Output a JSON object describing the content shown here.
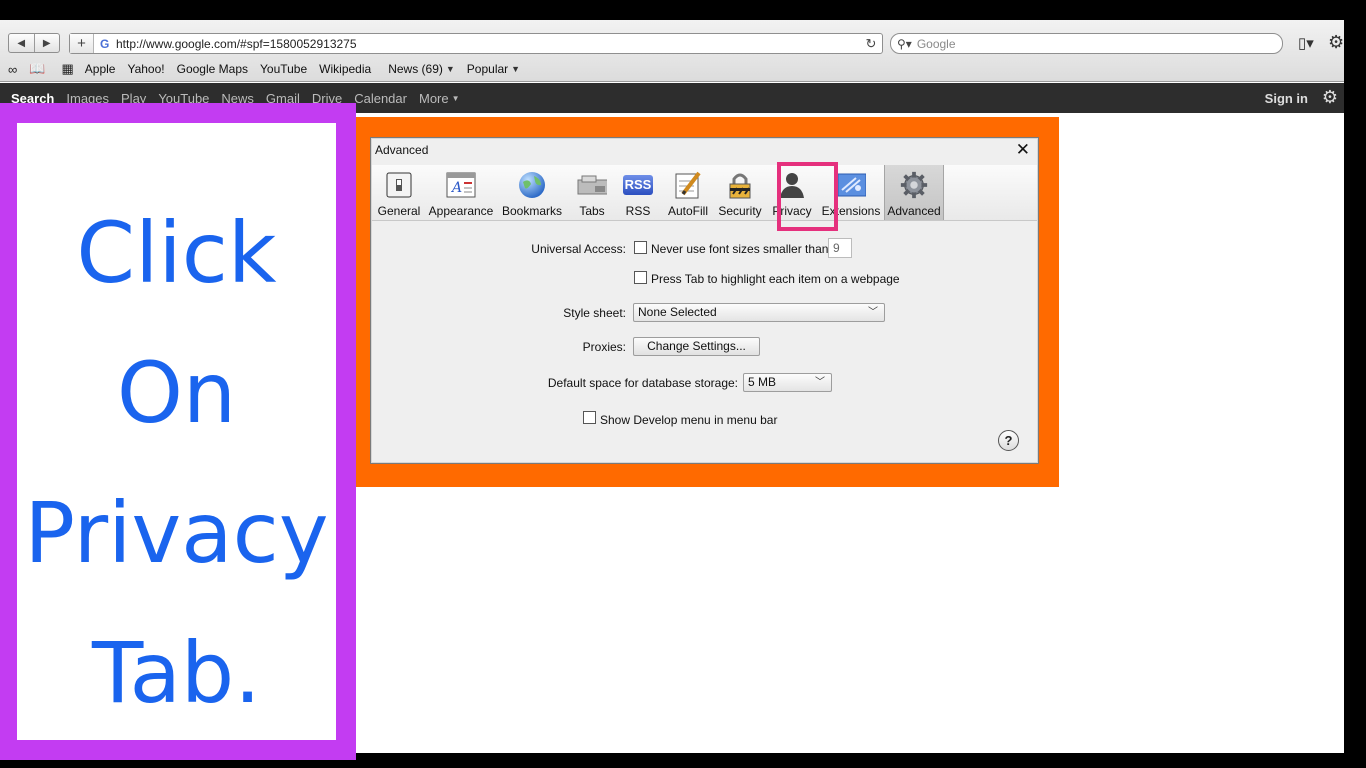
{
  "browser": {
    "url": "http://www.google.com/#spf=1580052913275",
    "search_placeholder": "Google",
    "bookmarks": [
      {
        "label": "Apple"
      },
      {
        "label": "Yahoo!"
      },
      {
        "label": "Google Maps"
      },
      {
        "label": "YouTube"
      },
      {
        "label": "Wikipedia"
      },
      {
        "label": "News (69)"
      },
      {
        "label": "Popular"
      }
    ]
  },
  "google_bar": {
    "items": [
      "Search",
      "Images",
      "Play",
      "YouTube",
      "News",
      "Gmail",
      "Drive",
      "Calendar",
      "More"
    ],
    "sign_in": "Sign in"
  },
  "instruction": {
    "line1": "Click On",
    "line2": "Privacy",
    "line3": "Tab."
  },
  "dialog": {
    "title": "Advanced",
    "tabs": [
      {
        "label": "General",
        "icon": "general-switch-icon"
      },
      {
        "label": "Appearance",
        "icon": "appearance-icon"
      },
      {
        "label": "Bookmarks",
        "icon": "bookmarks-globe-icon"
      },
      {
        "label": "Tabs",
        "icon": "tabs-icon"
      },
      {
        "label": "RSS",
        "icon": "rss-icon"
      },
      {
        "label": "AutoFill",
        "icon": "autofill-pencil-icon"
      },
      {
        "label": "Security",
        "icon": "security-lock-icon"
      },
      {
        "label": "Privacy",
        "icon": "privacy-person-icon"
      },
      {
        "label": "Extensions",
        "icon": "extensions-puzzle-icon"
      },
      {
        "label": "Advanced",
        "icon": "advanced-gear-icon"
      }
    ],
    "selected_tab": "Advanced",
    "rss_icon_text": "RSS",
    "universal_access_label": "Universal Access:",
    "font_size_option": "Never use font sizes smaller than",
    "font_size_value": "9",
    "tab_highlight_option": "Press Tab to highlight each item on a webpage",
    "style_sheet_label": "Style sheet:",
    "style_sheet_value": "None Selected",
    "proxies_label": "Proxies:",
    "proxies_button": "Change Settings...",
    "db_storage_label": "Default space for database storage:",
    "db_storage_value": "5 MB",
    "develop_menu_option": "Show Develop menu in menu bar",
    "help_symbol": "?"
  },
  "colors": {
    "instruction_text": "#1a64ee",
    "sidebar_frame": "#c33cf2",
    "dialog_frame": "#ff6a00",
    "highlight_box": "#e5307d"
  }
}
